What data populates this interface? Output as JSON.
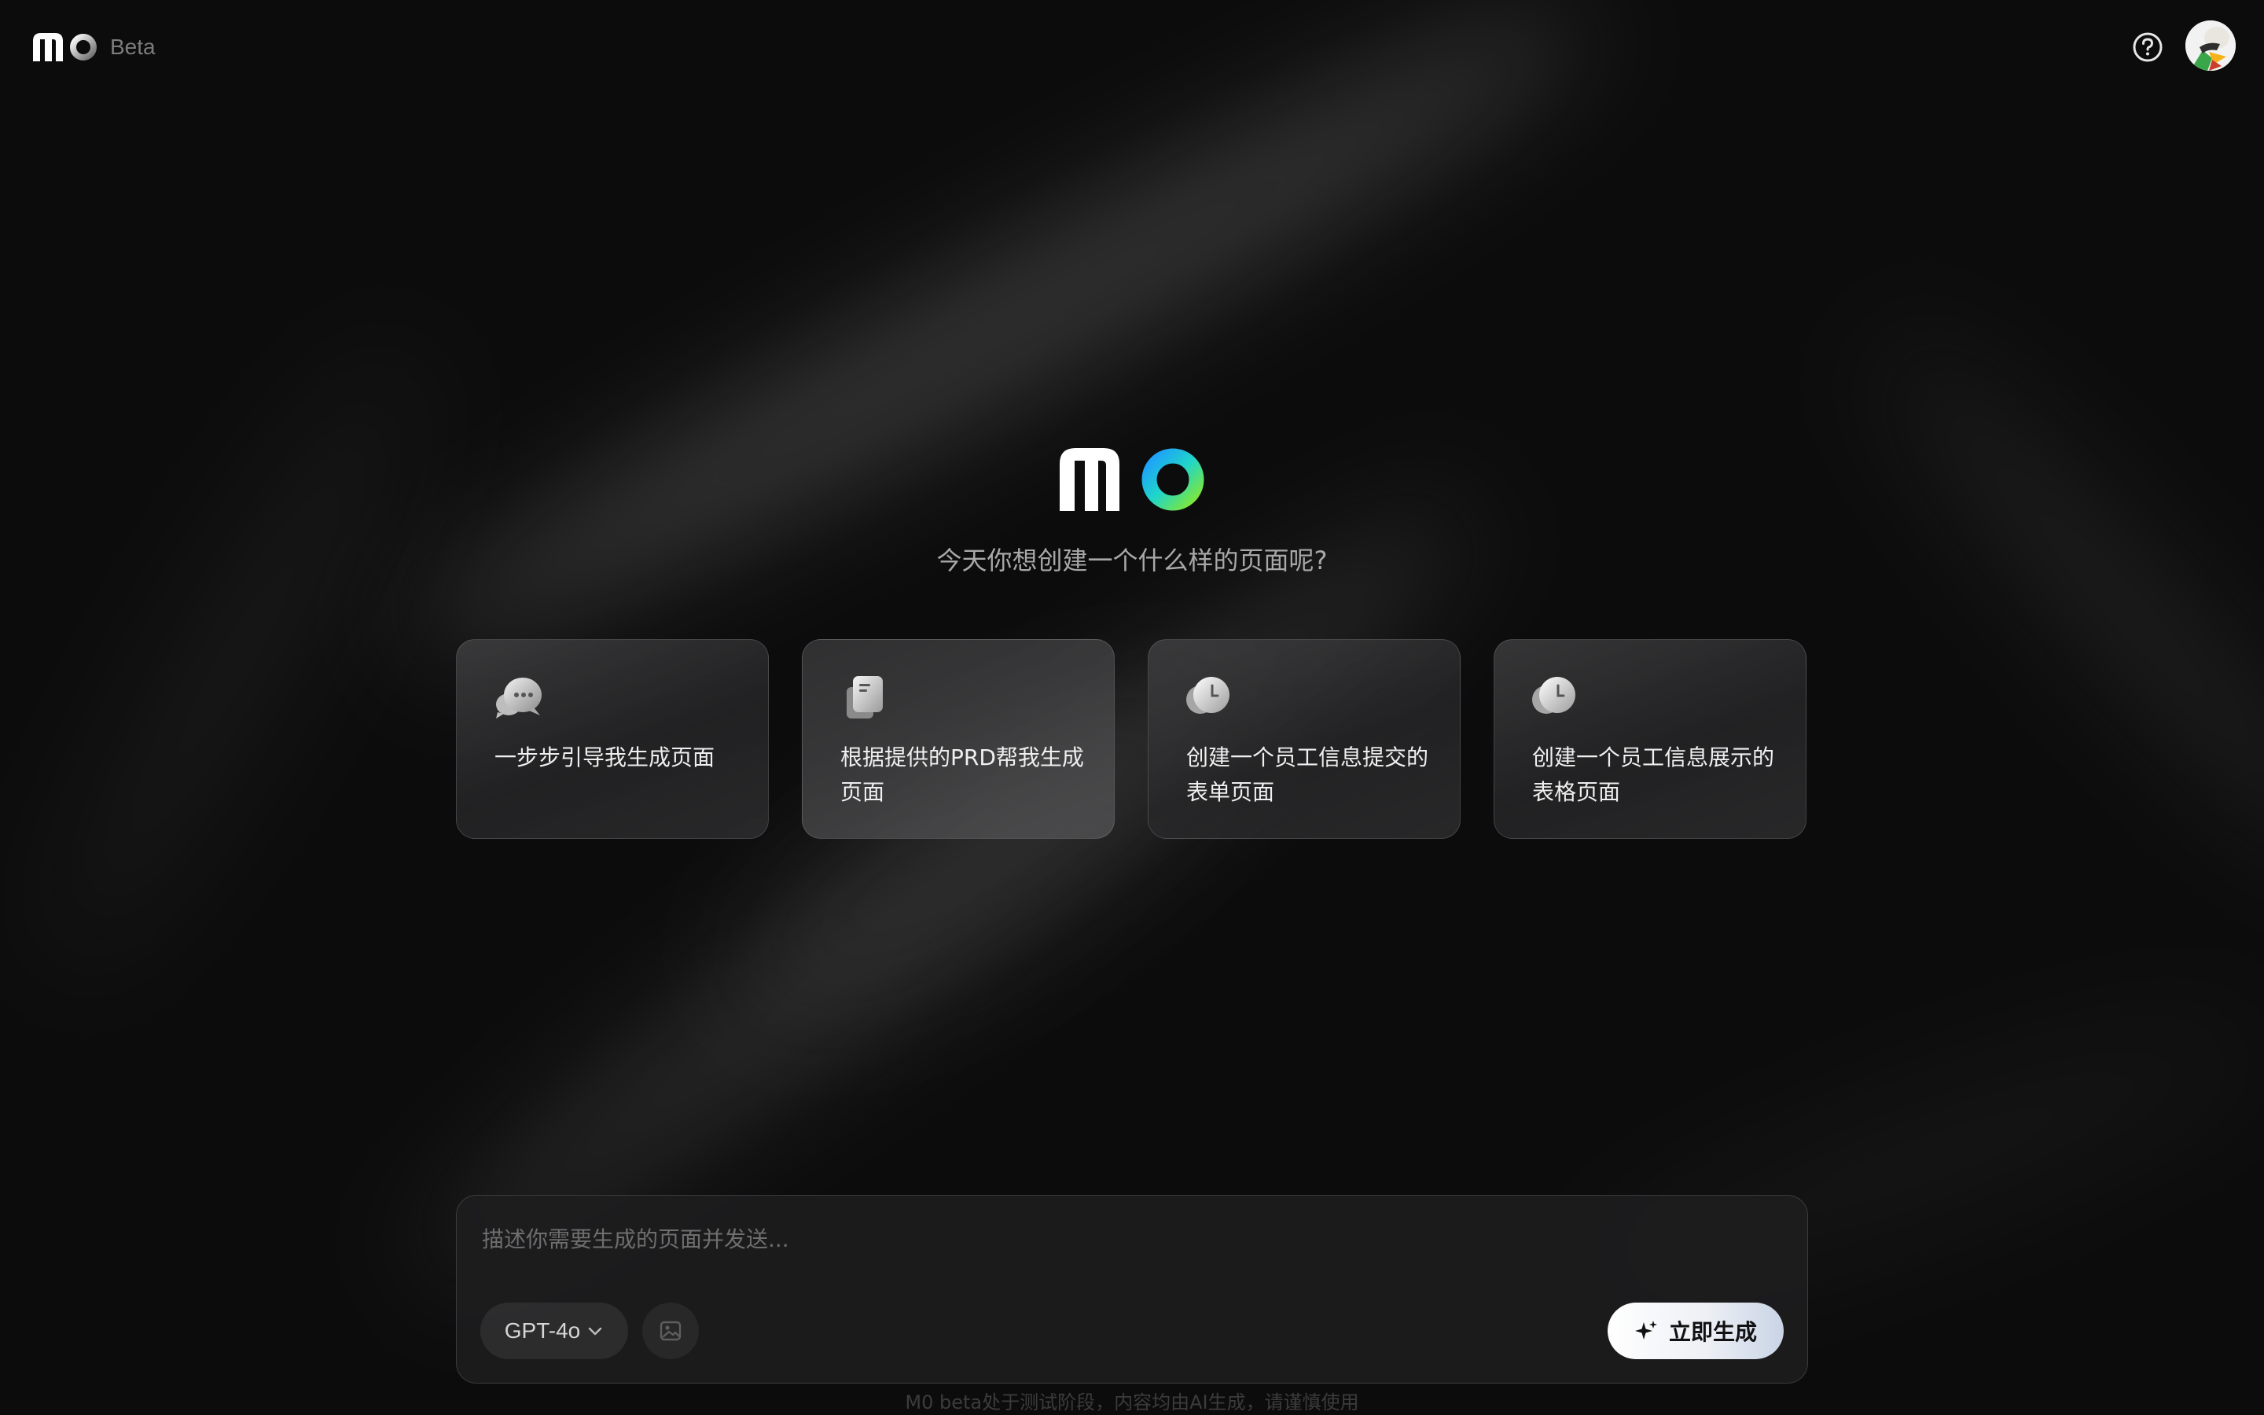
{
  "header": {
    "logo_text": "M0",
    "beta_label": "Beta",
    "help_icon": "question-circle-icon",
    "avatar_icon": "user-avatar"
  },
  "hero": {
    "logo_text": "M0",
    "title": "今天你想创建一个什么样的页面呢?"
  },
  "suggestions": [
    {
      "icon": "chat-bubbles-icon",
      "text": "一步步引导我生成页面"
    },
    {
      "icon": "document-icon",
      "text": "根据提供的PRD帮我生成页面"
    },
    {
      "icon": "clock-icon",
      "text": "创建一个员工信息提交的表单页面"
    },
    {
      "icon": "clock-icon",
      "text": "创建一个员工信息展示的表格页面"
    }
  ],
  "prompt": {
    "placeholder": "描述你需要生成的页面并发送...",
    "value": "",
    "model": "GPT-4o",
    "image_icon": "image-icon",
    "generate_label": "立即生成",
    "generate_icon": "sparkle-icon"
  },
  "footer": {
    "note": "M0 beta处于测试阶段，内容均由AI生成，请谨慎使用"
  },
  "colors": {
    "background": "#0c0c0d",
    "card_border": "#3a3a3c",
    "logo_gradient_start": "#22a7ff",
    "logo_gradient_end": "#7ee23a",
    "generate_button": "#ffffff"
  }
}
